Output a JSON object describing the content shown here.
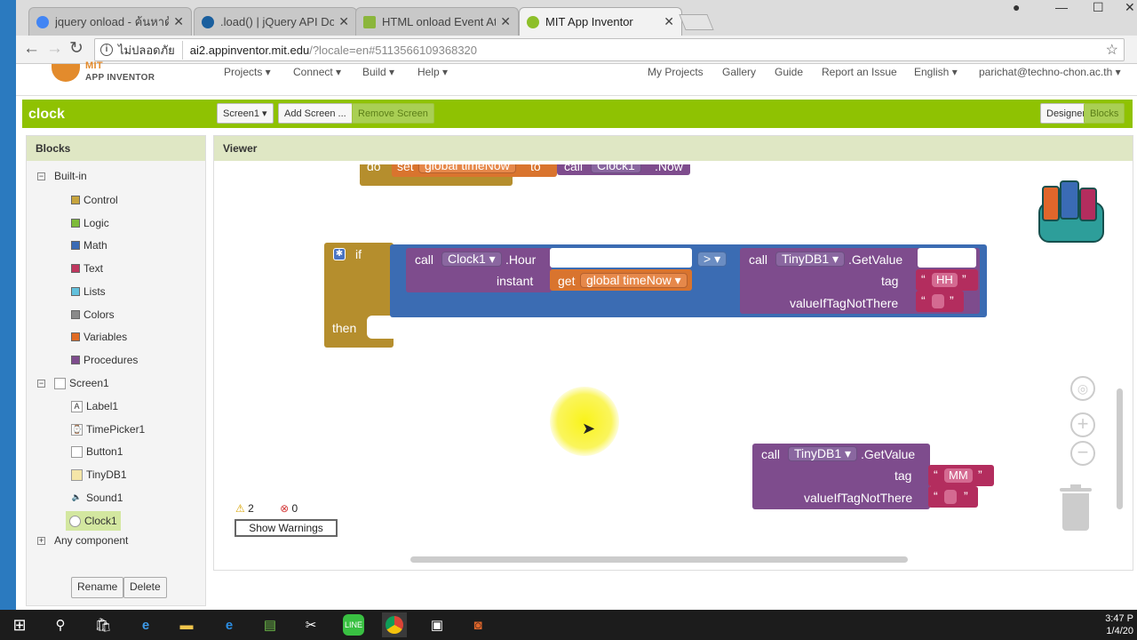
{
  "browser": {
    "tabs": [
      {
        "title": "jquery onload - ค้นหาด้วย",
        "color": "#4285f4"
      },
      {
        "title": ".load() | jQuery API Docu",
        "color": "#1a5f9e"
      },
      {
        "title": "HTML onload Event Attri",
        "color": "#8bb63c"
      },
      {
        "title": "MIT App Inventor",
        "color": "#8dbf2a"
      }
    ],
    "close_glyph": "✕",
    "address": {
      "security": "ไม่ปลอดภัย",
      "host": "ai2.appinventor.mit.edu",
      "path": "/?locale=en#5113566109368320"
    }
  },
  "appinventor": {
    "logo": {
      "line1": "MIT",
      "line2": "APP INVENTOR"
    },
    "menus": [
      "Projects ▾",
      "Connect ▾",
      "Build ▾",
      "Help ▾"
    ],
    "right_menus": [
      "My Projects",
      "Gallery",
      "Guide",
      "Report an Issue",
      "English ▾",
      "parichat@techno-chon.ac.th ▾"
    ],
    "project_name": "clock",
    "screen_select": "Screen1 ▾",
    "add_screen": "Add Screen ...",
    "remove_screen": "Remove Screen",
    "designer": "Designer",
    "blocks": "Blocks"
  },
  "blocks_panel": {
    "title": "Blocks",
    "builtin_label": "Built-in",
    "builtin": [
      {
        "label": "Control",
        "color": "#c7a43d"
      },
      {
        "label": "Logic",
        "color": "#7ebb3a"
      },
      {
        "label": "Math",
        "color": "#3a6bb5"
      },
      {
        "label": "Text",
        "color": "#c0375f"
      },
      {
        "label": "Lists",
        "color": "#62c1dd"
      },
      {
        "label": "Colors",
        "color": "#8a8a8a"
      },
      {
        "label": "Variables",
        "color": "#e06b24"
      },
      {
        "label": "Procedures",
        "color": "#7e4c8d"
      }
    ],
    "screen_label": "Screen1",
    "components": [
      "Label1",
      "TimePicker1",
      "Button1",
      "TinyDB1",
      "Sound1",
      "Clock1"
    ],
    "any_component": "Any component",
    "rename": "Rename",
    "delete": "Delete"
  },
  "viewer": {
    "title": "Viewer",
    "top_block": {
      "do": "do",
      "set": "set",
      "var": "global timeNow",
      "to": "to",
      "call": "call",
      "comp": "Clock1",
      "method": ".Now"
    },
    "if_block": {
      "if": "if",
      "then": "then",
      "call": "call",
      "comp": "Clock1 ▾",
      "method": ".Hour",
      "instant": "instant",
      "get": "get",
      "var": "global timeNow ▾",
      "op": "> ▾"
    },
    "getvalue1": {
      "call": "call",
      "comp": "TinyDB1 ▾",
      "method": ".GetValue",
      "tag": "tag",
      "tag_value": "HH",
      "default_label": "valueIfTagNotThere"
    },
    "getvalue2": {
      "call": "call",
      "comp": "TinyDB1 ▾",
      "method": ".GetValue",
      "tag": "tag",
      "tag_value": "MM",
      "default_label": "valueIfTagNotThere"
    },
    "quote_open": "“",
    "quote_close": "”",
    "warnings": {
      "warn_count": "2",
      "error_count": "0",
      "show_button": "Show Warnings"
    }
  },
  "taskbar": {
    "time": "3:47 P",
    "date": "1/4/20"
  }
}
